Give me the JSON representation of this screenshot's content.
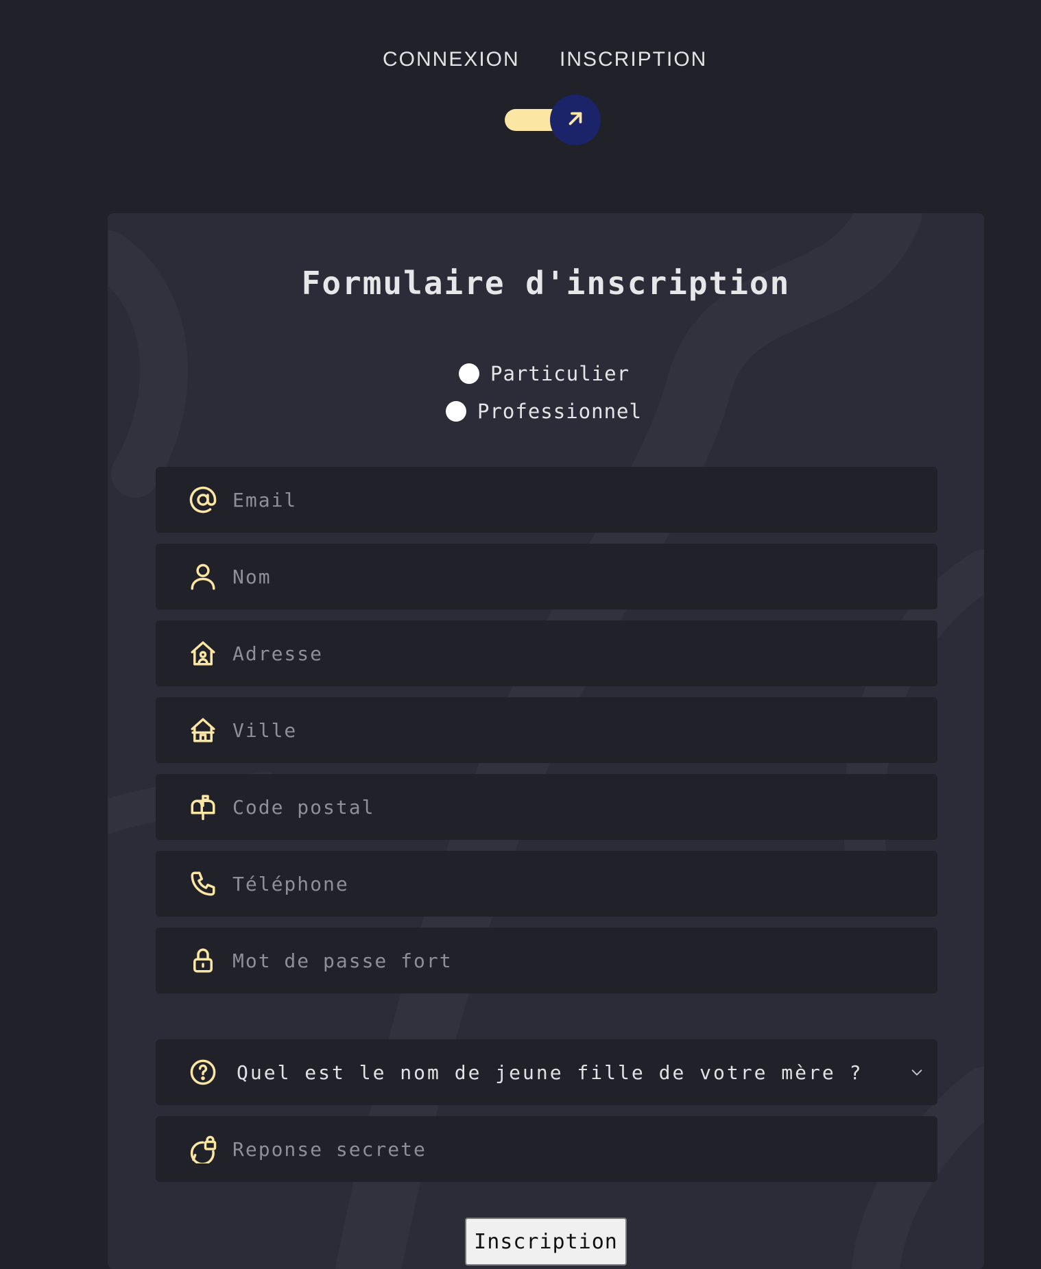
{
  "tabs": {
    "connexion": "CONNEXION",
    "inscription": "INSCRIPTION",
    "active": "inscription"
  },
  "toggle": {
    "icon": "arrow-up-right-icon",
    "state": "on",
    "track_color": "#fbe6a4",
    "knob_color": "#1b2369"
  },
  "form": {
    "title": "Formulaire d'inscription",
    "account_type": {
      "options": [
        "Particulier",
        "Professionnel"
      ],
      "selected": null
    },
    "fields": {
      "email": {
        "placeholder": "Email",
        "icon": "at-sign-icon",
        "value": ""
      },
      "nom": {
        "placeholder": "Nom",
        "icon": "user-icon",
        "value": ""
      },
      "adresse": {
        "placeholder": "Adresse",
        "icon": "home-user-icon",
        "value": ""
      },
      "ville": {
        "placeholder": "Ville",
        "icon": "home-icon",
        "value": ""
      },
      "code_postal": {
        "placeholder": "Code postal",
        "icon": "mailbox-icon",
        "value": ""
      },
      "telephone": {
        "placeholder": "Téléphone",
        "icon": "phone-icon",
        "value": ""
      },
      "mot_de_passe": {
        "placeholder": "Mot de passe fort",
        "icon": "lock-icon",
        "value": ""
      },
      "reponse": {
        "placeholder": "Reponse secrete",
        "icon": "chat-lock-icon",
        "value": ""
      }
    },
    "security_question": {
      "selected": "Quel est le nom de jeune fille de votre mère ?",
      "icon": "question-circle-icon"
    },
    "submit_label": "Inscription"
  },
  "colors": {
    "page_background": "#212129",
    "card_background": "#2c2c38",
    "field_background": "#212129",
    "icon_accent": "#fbe6a4"
  }
}
